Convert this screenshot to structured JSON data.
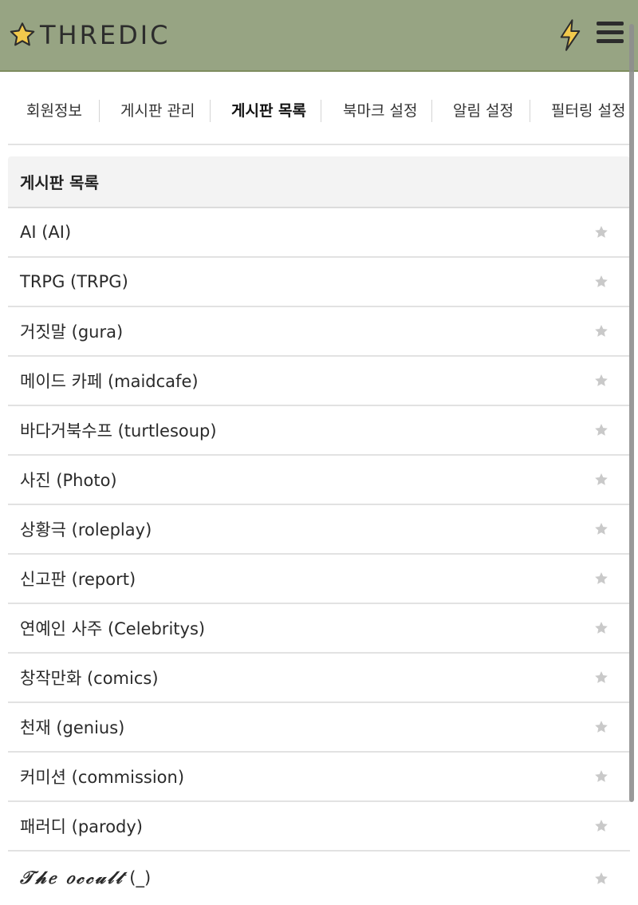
{
  "header": {
    "logo_text": "THREDIC",
    "colors": {
      "bar": "#97a483",
      "logo_star": "#f2c94c",
      "bolt": "#f2c94c"
    },
    "icons": [
      "star-logo-icon",
      "lightning-icon",
      "hamburger-menu-icon"
    ]
  },
  "tabs": [
    {
      "label": "회원정보",
      "active": false
    },
    {
      "label": "게시판 관리",
      "active": false
    },
    {
      "label": "게시판 목록",
      "active": true
    },
    {
      "label": "북마크 설정",
      "active": false
    },
    {
      "label": "알림 설정",
      "active": false
    },
    {
      "label": "필터링 설정",
      "active": false
    }
  ],
  "board_list": {
    "title": "게시판 목록",
    "star_icon": "star-icon",
    "items": [
      {
        "label": "AI (AI)"
      },
      {
        "label": "TRPG (TRPG)"
      },
      {
        "label": "거짓말 (gura)"
      },
      {
        "label": "메이드 카페 (maidcafe)"
      },
      {
        "label": "바다거북수프 (turtlesoup)"
      },
      {
        "label": "사진 (Photo)"
      },
      {
        "label": "상황극 (roleplay)"
      },
      {
        "label": "신고판 (report)"
      },
      {
        "label": "연예인 사주 (Celebritys)"
      },
      {
        "label": "창작만화 (comics)"
      },
      {
        "label": "천재 (genius)"
      },
      {
        "label": "커미션 (commission)"
      },
      {
        "label": "패러디 (parody)"
      },
      {
        "label_styled": "𝒯𝒽𝑒 𝑜𝒸𝒸𝓊𝓁𝓉",
        "label_suffix": " (_)"
      }
    ]
  }
}
